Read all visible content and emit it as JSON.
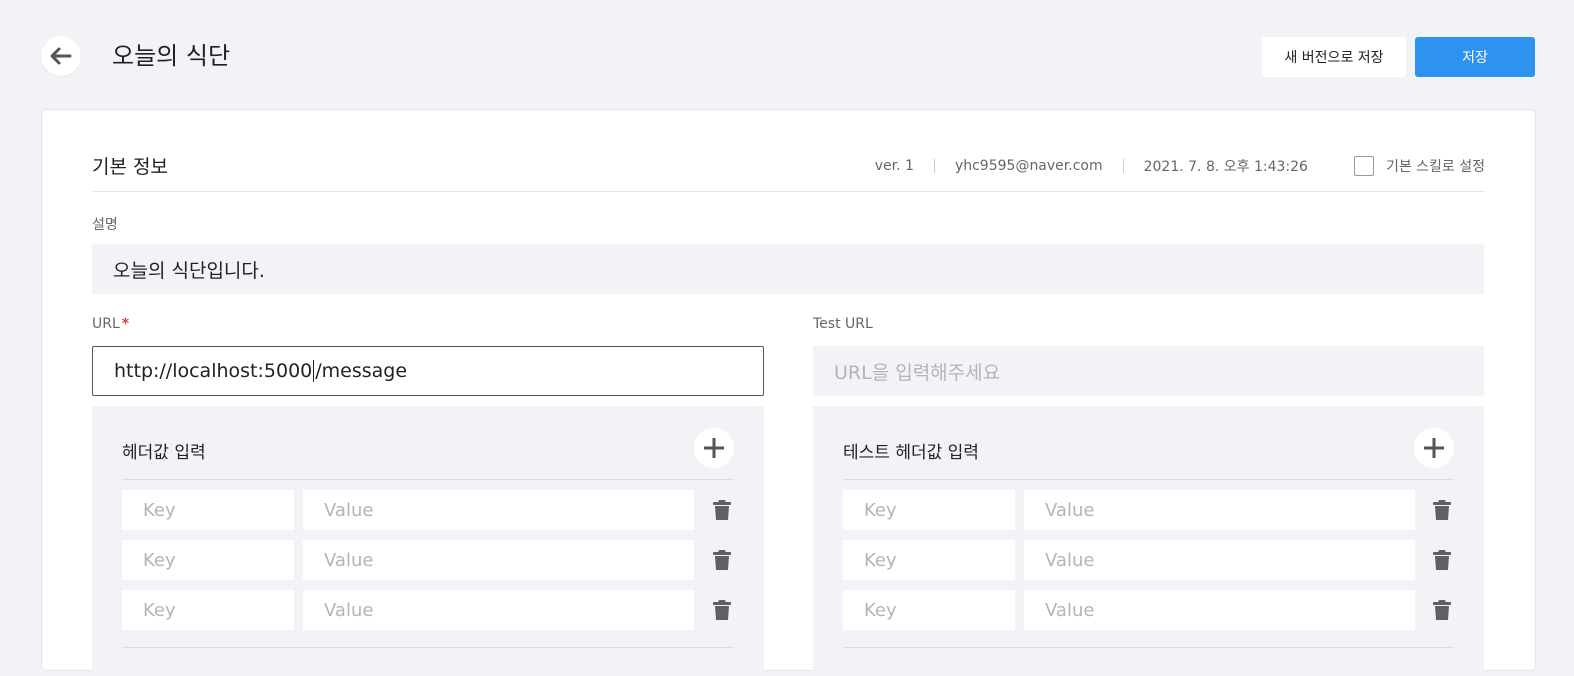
{
  "header": {
    "title": "오늘의 식단",
    "save_new_version_label": "새 버전으로 저장",
    "save_label": "저장"
  },
  "basic_info": {
    "title": "기본 정보",
    "version": "ver. 1",
    "author": "yhc9595@naver.com",
    "date": "2021. 7. 8. 오후 1:43:26",
    "default_skill_label": "기본 스킬로 설정",
    "default_skill_checked": false
  },
  "description": {
    "label": "설명",
    "value": "오늘의 식단입니다."
  },
  "url": {
    "label": "URL",
    "required_mark": "*",
    "value_before_caret": "http://localhost:5000",
    "value_after_caret": "/message"
  },
  "test_url": {
    "label": "Test URL",
    "placeholder": "URL을 입력해주세요"
  },
  "headers_panel": {
    "title": "헤더값 입력",
    "rows": [
      {
        "key_placeholder": "Key",
        "value_placeholder": "Value"
      },
      {
        "key_placeholder": "Key",
        "value_placeholder": "Value"
      },
      {
        "key_placeholder": "Key",
        "value_placeholder": "Value"
      }
    ]
  },
  "test_headers_panel": {
    "title": "테스트 헤더값 입력",
    "rows": [
      {
        "key_placeholder": "Key",
        "value_placeholder": "Value"
      },
      {
        "key_placeholder": "Key",
        "value_placeholder": "Value"
      },
      {
        "key_placeholder": "Key",
        "value_placeholder": "Value"
      }
    ]
  },
  "icons": {
    "back": "arrow-left-icon",
    "add": "plus-icon",
    "delete": "trash-icon"
  },
  "colors": {
    "primary": "#2e93ef",
    "background": "#f2f3f7",
    "required": "#e53535"
  }
}
